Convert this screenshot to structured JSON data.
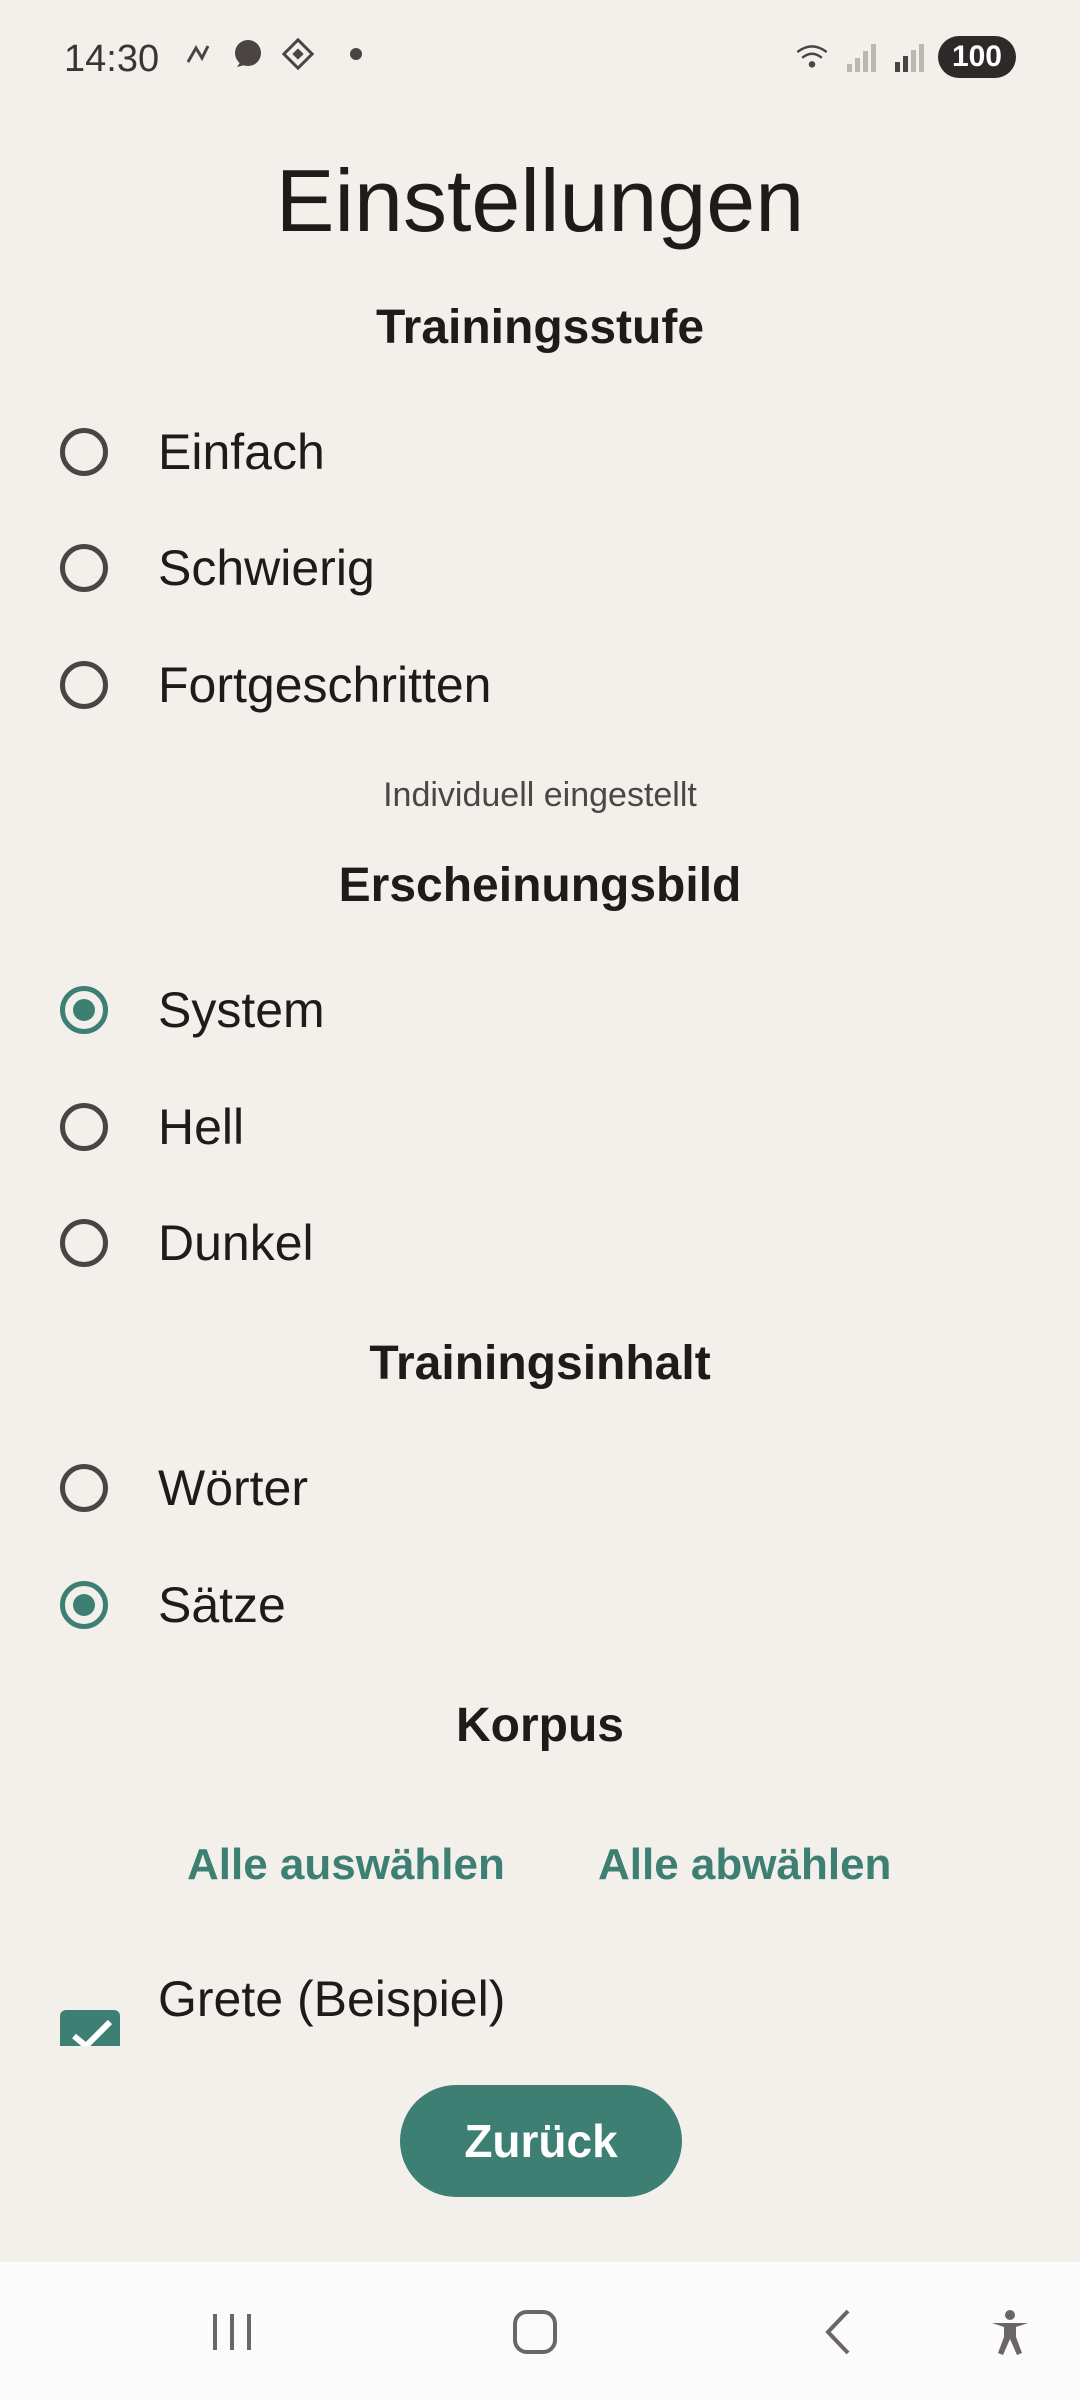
{
  "status": {
    "time": "14:30",
    "battery": "100",
    "left_icons": [
      "nfc-icon",
      "message-bubble-icon",
      "diamond-pattern-icon",
      "dot-icon"
    ],
    "right_icons": [
      "wifi-icon",
      "signal-icon",
      "roaming-signal-icon"
    ]
  },
  "page": {
    "title": "Einstellungen"
  },
  "training_level": {
    "title": "Trainingsstufe",
    "options": [
      "Einfach",
      "Schwierig",
      "Fortgeschritten"
    ],
    "hint": "Individuell eingestellt"
  },
  "appearance": {
    "title": "Erscheinungsbild",
    "options": [
      "System",
      "Hell",
      "Dunkel"
    ],
    "selected": "System"
  },
  "training_content": {
    "title": "Trainingsinhalt",
    "options": [
      "Wörter",
      "Sätze"
    ],
    "selected": "Sätze"
  },
  "corpus": {
    "title": "Korpus",
    "select_all": "Alle auswählen",
    "deselect_all": "Alle abwählen",
    "items": [
      {
        "label": "Grete (Beispiel)",
        "checked": true
      }
    ]
  },
  "back_button": "Zurück",
  "accent_color": "#3d7f73"
}
